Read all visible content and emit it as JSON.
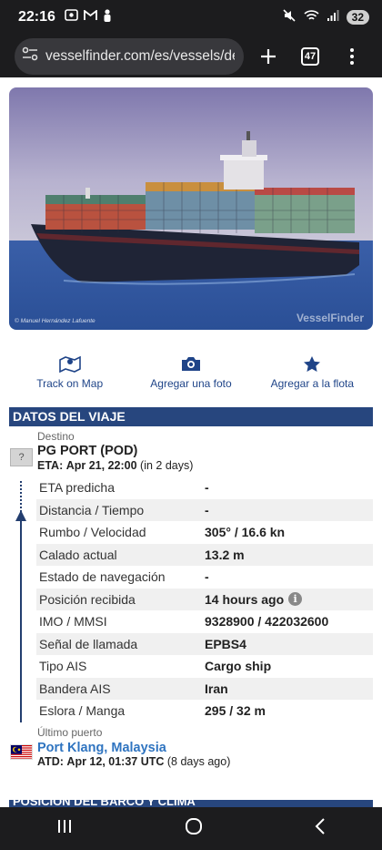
{
  "status": {
    "time": "22:16",
    "battery": "32"
  },
  "browser": {
    "url": "vesselfinder.com/es/vessels/det",
    "tabs": "47"
  },
  "hero": {
    "watermark": "VesselFinder",
    "credit": "© Manuel Hernández Lafuente"
  },
  "actions": [
    {
      "label": "Track on Map",
      "icon": "map-pin-icon"
    },
    {
      "label": "Agregar una foto",
      "icon": "camera-icon"
    },
    {
      "label": "Agregar a la flota",
      "icon": "star-icon"
    }
  ],
  "section": {
    "title": "DATOS DEL VIAJE"
  },
  "destination": {
    "label": "Destino",
    "badge": "?",
    "name": "PG PORT (POD)",
    "eta_label": "ETA:",
    "eta_value": "Apr 21, 22:00",
    "eta_relative": "(in 2 days)"
  },
  "details": [
    {
      "key": "ETA predicha",
      "value": "-"
    },
    {
      "key": "Distancia / Tiempo",
      "value": "-"
    },
    {
      "key": "Rumbo / Velocidad",
      "value": "305° / 16.6 kn"
    },
    {
      "key": "Calado actual",
      "value": "13.2 m"
    },
    {
      "key": "Estado de navegación",
      "value": "-"
    },
    {
      "key": "Posición recibida",
      "value": "14 hours ago"
    },
    {
      "key": "IMO / MMSI",
      "value": "9328900 / 422032600"
    },
    {
      "key": "Señal de llamada",
      "value": "EPBS4"
    },
    {
      "key": "Tipo AIS",
      "value": "Cargo ship"
    },
    {
      "key": "Bandera AIS",
      "value": "Iran"
    },
    {
      "key": "Eslora / Manga",
      "value": "295 / 32 m"
    }
  ],
  "last_port": {
    "label": "Último puerto",
    "name": "Port Klang, Malaysia",
    "atd_label": "ATD:",
    "atd_value": "Apr 12, 01:37 UTC",
    "atd_relative": "(8 days ago)"
  },
  "section2": {
    "title": "POSICIÓN DEL BARCO Y CLIMA"
  },
  "colors": {
    "header": "#27467e",
    "link": "#2f74c0",
    "action": "#1f4488"
  }
}
